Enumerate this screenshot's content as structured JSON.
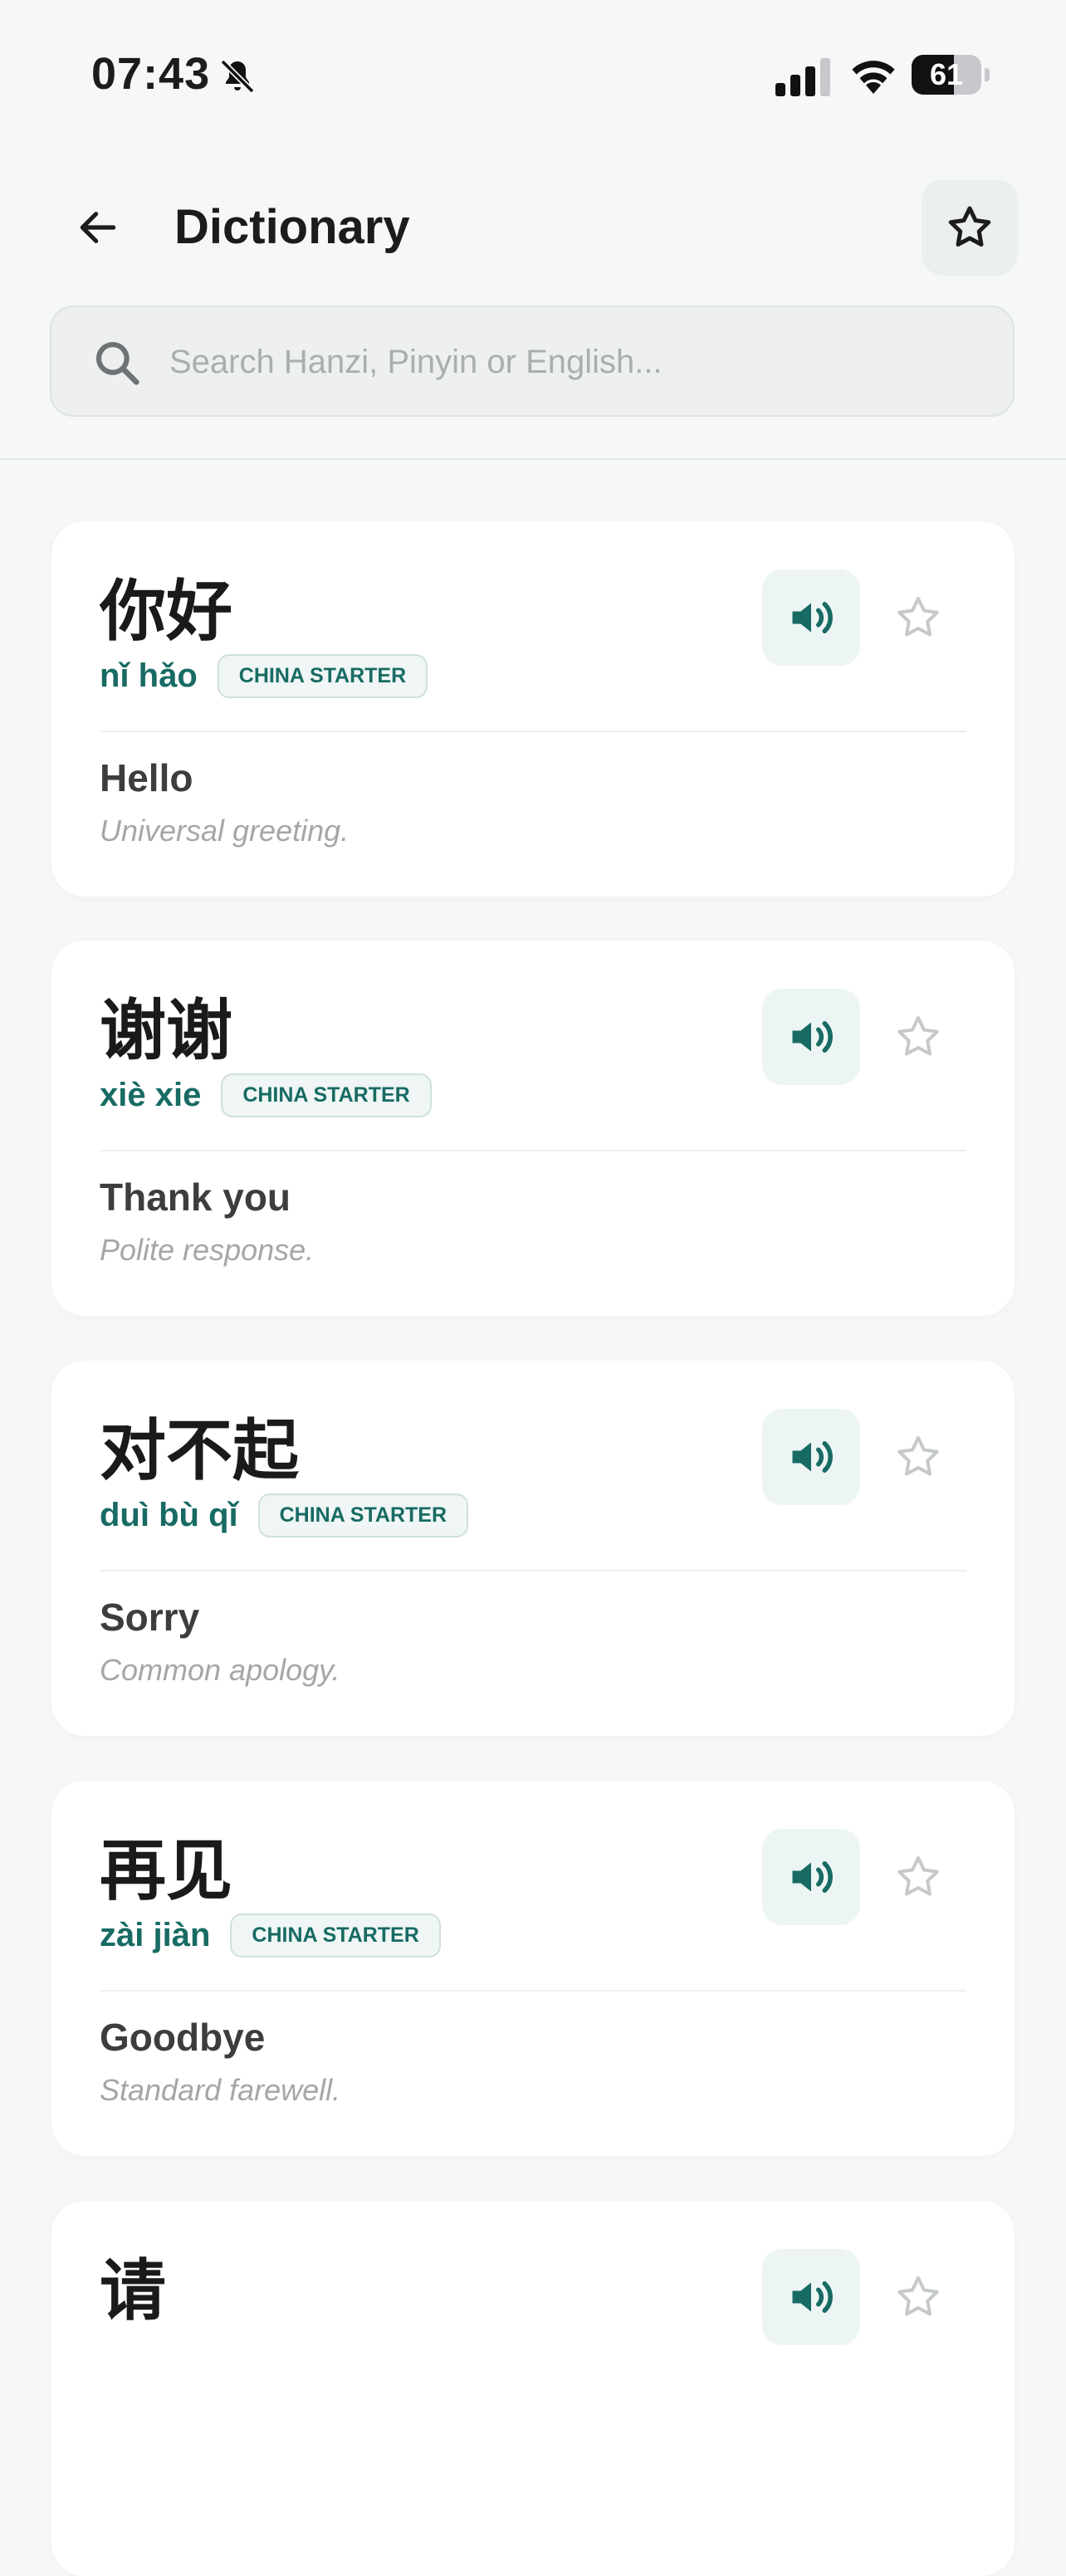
{
  "status_bar": {
    "time": "07:43",
    "battery_percent": "61",
    "battery_level": 0.61,
    "icons": [
      "bell-slash-icon",
      "cellular-signal-icon",
      "wifi-icon",
      "battery-icon"
    ]
  },
  "header": {
    "title": "Dictionary",
    "back_icon": "arrow-left-icon",
    "favorites_icon": "star-icon"
  },
  "search": {
    "placeholder": "Search Hanzi, Pinyin or English..."
  },
  "colors": {
    "accent": "#176b63",
    "background": "#f6f8f8",
    "card": "#ffffff"
  },
  "entries": [
    {
      "hanzi": "你好",
      "pinyin": "nǐ hǎo",
      "level": "CHINA STARTER",
      "meaning": "Hello",
      "note": "Universal greeting."
    },
    {
      "hanzi": "谢谢",
      "pinyin": "xiè xie",
      "level": "CHINA STARTER",
      "meaning": "Thank you",
      "note": "Polite response."
    },
    {
      "hanzi": "对不起",
      "pinyin": "duì bù qǐ",
      "level": "CHINA STARTER",
      "meaning": "Sorry",
      "note": "Common apology."
    },
    {
      "hanzi": "再见",
      "pinyin": "zài jiàn",
      "level": "CHINA STARTER",
      "meaning": "Goodbye",
      "note": "Standard farewell."
    },
    {
      "hanzi": "请",
      "pinyin": "",
      "level": "",
      "meaning": "",
      "note": ""
    }
  ]
}
